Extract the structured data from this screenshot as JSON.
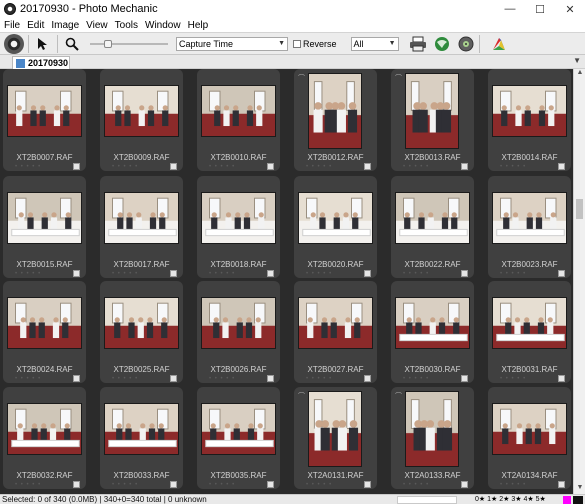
{
  "window": {
    "title": "20170930 - Photo Mechanic",
    "minimize": "—",
    "maximize": "☐",
    "close": "✕"
  },
  "menu": [
    "File",
    "Edit",
    "Image",
    "View",
    "Tools",
    "Window",
    "Help"
  ],
  "toolbar": {
    "sort_by": "Capture Time",
    "reverse_label": "Reverse",
    "filter": "All",
    "slider_value": 0.2
  },
  "tab": {
    "label": "20170930"
  },
  "thumbnails": [
    {
      "name": "XT2B0007.RAF",
      "flag": false
    },
    {
      "name": "XT2B0009.RAF",
      "flag": false
    },
    {
      "name": "XT2B0010.RAF",
      "flag": false
    },
    {
      "name": "XT2B0012.RAF",
      "flag": true
    },
    {
      "name": "XT2B0013.RAF",
      "flag": true
    },
    {
      "name": "XT2B0014.RAF",
      "flag": false
    },
    {
      "name": "XT2B0015.RAF",
      "flag": false
    },
    {
      "name": "XT2B0017.RAF",
      "flag": false
    },
    {
      "name": "XT2B0018.RAF",
      "flag": false
    },
    {
      "name": "XT2B0020.RAF",
      "flag": false
    },
    {
      "name": "XT2B0022.RAF",
      "flag": false
    },
    {
      "name": "XT2B0023.RAF",
      "flag": false
    },
    {
      "name": "XT2B0024.RAF",
      "flag": false
    },
    {
      "name": "XT2B0025.RAF",
      "flag": false
    },
    {
      "name": "XT2B0026.RAF",
      "flag": false
    },
    {
      "name": "XT2B0027.RAF",
      "flag": false
    },
    {
      "name": "XT2B0030.RAF",
      "flag": false
    },
    {
      "name": "XT2B0031.RAF",
      "flag": false
    },
    {
      "name": "XT2B0032.RAF",
      "flag": false
    },
    {
      "name": "XT2B0033.RAF",
      "flag": false
    },
    {
      "name": "XT2B0035.RAF",
      "flag": false
    },
    {
      "name": "XT2A0131.RAF",
      "flag": true
    },
    {
      "name": "XT2A0133.RAF",
      "flag": true
    },
    {
      "name": "XT2A0134.RAF",
      "flag": false
    }
  ],
  "status": {
    "text": "Selected: 0 of 340 (0.0MB) | 340+0=340 total | 0 unknown",
    "ratings": "0★ 1★ 2★ 3★ 4★ 5★"
  },
  "colors": {
    "sheet_bg": "#2b2b2b",
    "cell_bg": "#404040",
    "status_magenta": "#ff00ff"
  }
}
